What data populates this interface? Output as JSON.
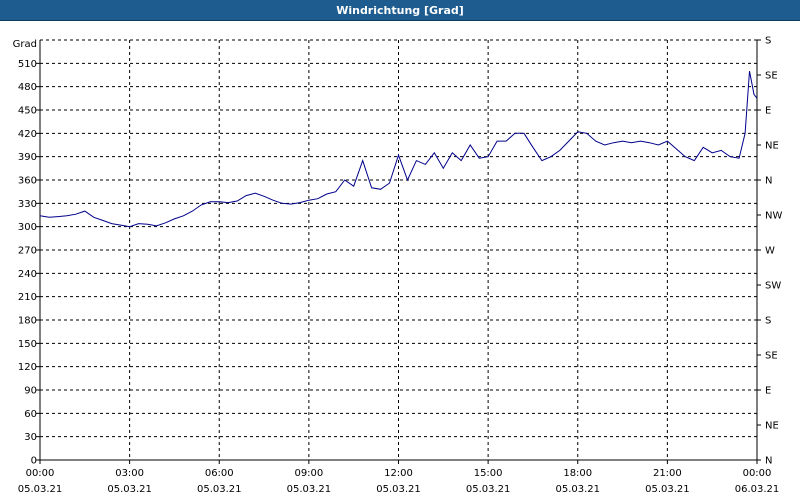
{
  "window": {
    "title": "Windrichtung [Grad]"
  },
  "chart_data": {
    "type": "line",
    "title": "Windrichtung [Grad]",
    "ylabel": "Grad",
    "xlabel": "",
    "ylim": [
      0,
      540
    ],
    "y_ticks": [
      0,
      30,
      60,
      90,
      120,
      150,
      180,
      210,
      240,
      270,
      300,
      330,
      360,
      390,
      420,
      450,
      480,
      510
    ],
    "y2_ticks": [
      "N",
      "NE",
      "E",
      "SE",
      "S",
      "SW",
      "W",
      "NW",
      "N",
      "NE",
      "E",
      "SE",
      "S"
    ],
    "x_ticks": [
      {
        "time": "00:00",
        "date": "05.03.21"
      },
      {
        "time": "03:00",
        "date": "05.03.21"
      },
      {
        "time": "06:00",
        "date": "05.03.21"
      },
      {
        "time": "09:00",
        "date": "05.03.21"
      },
      {
        "time": "12:00",
        "date": "05.03.21"
      },
      {
        "time": "15:00",
        "date": "05.03.21"
      },
      {
        "time": "18:00",
        "date": "05.03.21"
      },
      {
        "time": "21:00",
        "date": "05.03.21"
      },
      {
        "time": "00:00",
        "date": "06.03.21"
      }
    ],
    "xlim_hours": [
      0,
      24
    ],
    "grid": true,
    "line_color": "#00008b",
    "series": [
      {
        "x": [
          0,
          0.3,
          0.6,
          0.9,
          1.2,
          1.5,
          1.8,
          2.1,
          2.4,
          2.7,
          3.0,
          3.3,
          3.6,
          3.9,
          4.2,
          4.5,
          4.8,
          5.1,
          5.4,
          5.7,
          6.0,
          6.3,
          6.6,
          6.9,
          7.2,
          7.5,
          7.8,
          8.1,
          8.4,
          8.7,
          9.0,
          9.3,
          9.6,
          9.9,
          10.2,
          10.5,
          10.8,
          11.1,
          11.4,
          11.7,
          12.0,
          12.3,
          12.6,
          12.9,
          13.2,
          13.5,
          13.8,
          14.1,
          14.4,
          14.7,
          15.0,
          15.3,
          15.6,
          15.9,
          16.2,
          16.5,
          16.8,
          17.1,
          17.4,
          17.7,
          18.0,
          18.3,
          18.6,
          18.9,
          19.2,
          19.5,
          19.8,
          20.1,
          20.4,
          20.7,
          21.0,
          21.3,
          21.6,
          21.9,
          22.2,
          22.5,
          22.8,
          23.1,
          23.4,
          23.6,
          23.75,
          23.9,
          24.0
        ],
        "values": [
          314,
          312,
          313,
          314,
          316,
          320,
          312,
          308,
          304,
          302,
          300,
          304,
          303,
          301,
          305,
          310,
          314,
          320,
          328,
          332,
          332,
          331,
          333,
          340,
          343,
          339,
          334,
          330,
          329,
          331,
          334,
          336,
          342,
          345,
          360,
          352,
          385,
          350,
          348,
          356,
          392,
          360,
          385,
          380,
          395,
          375,
          395,
          385,
          405,
          388,
          390,
          410,
          410,
          420,
          420,
          402,
          385,
          390,
          398,
          410,
          422,
          420,
          410,
          405,
          408,
          410,
          408,
          410,
          408,
          405,
          410,
          400,
          390,
          385,
          402,
          395,
          398,
          390,
          388,
          420,
          500,
          470,
          465
        ]
      }
    ]
  }
}
